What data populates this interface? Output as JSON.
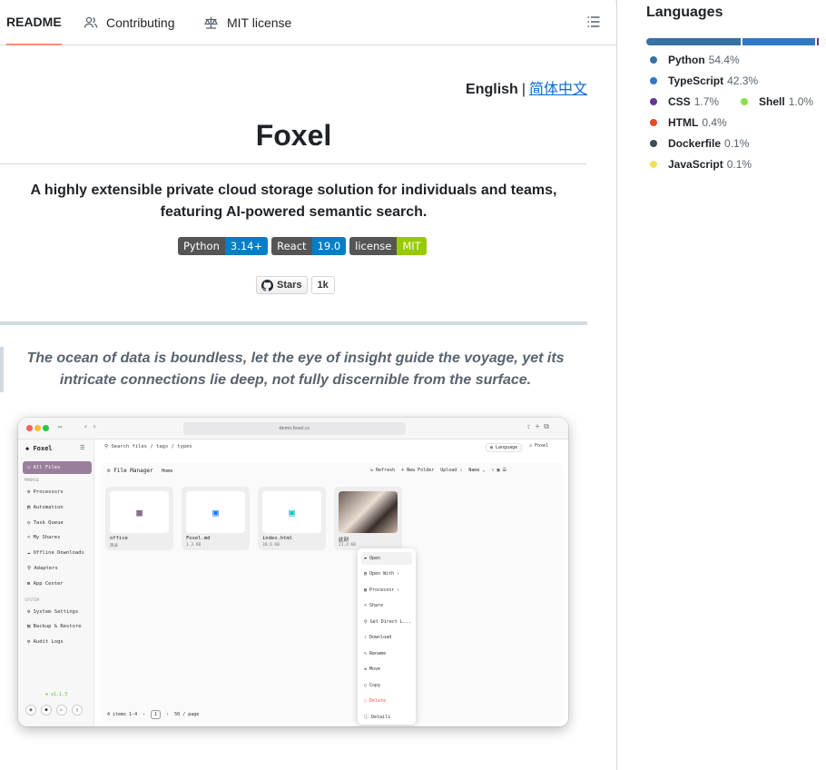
{
  "tabs": {
    "readme": "README",
    "contributing": "Contributing",
    "license": "MIT license"
  },
  "lang_switch": {
    "english": "English",
    "separator": "|",
    "chinese": "简体中文"
  },
  "title": "Foxel",
  "tagline_line1": "A highly extensible private cloud storage solution for individuals and teams,",
  "tagline_line2": "featuring AI-powered semantic search.",
  "badges": [
    {
      "label": "Python",
      "value": "3.14+",
      "color": "#007ec6"
    },
    {
      "label": "React",
      "value": "19.0",
      "color": "#007ec6"
    },
    {
      "label": "license",
      "value": "MIT",
      "color": "#97ca00"
    }
  ],
  "stars": {
    "label": "Stars",
    "count": "1k"
  },
  "quote_line1": "The ocean of data is boundless, let the eye of insight guide the voyage, yet its",
  "quote_line2": "intricate connections lie deep, not fully discernible from the surface.",
  "screenshot": {
    "url": "demo.foxel.cc",
    "app_name": "Foxel",
    "search_placeholder": "Search files / tags / types",
    "language_btn": "Language",
    "user": "Foxel",
    "sidebar": {
      "all_files": "All Files",
      "group_manage": "MANAGE",
      "processors": "Processors",
      "automation": "Automation",
      "task_queue": "Task Queue",
      "my_shares": "My Shares",
      "offline_downloads": "Offline Downloads",
      "adapters": "Adapters",
      "app_center": "App Center",
      "group_system": "SYSTEM",
      "system_settings": "System Settings",
      "backup_restore": "Backup & Restore",
      "audit_logs": "Audit Logs",
      "version": "v1.1.3"
    },
    "file_manager": "File Manager",
    "breadcrumb": "Home",
    "tools": {
      "refresh": "Refresh",
      "new_folder": "New Folder",
      "upload": "Upload",
      "sort": "Name"
    },
    "files": [
      {
        "name": "office",
        "size": "目录"
      },
      {
        "name": "Foxel.md",
        "size": "1.3 KB"
      },
      {
        "name": "index.html",
        "size": "30.6 KB"
      },
      {
        "name": "此刻",
        "size": "21.4 KB"
      }
    ],
    "context_menu": {
      "open": "Open",
      "open_with": "Open With",
      "processor": "Processor",
      "share": "Share",
      "direct_link": "Get Direct L...",
      "download": "Download",
      "rename": "Rename",
      "move": "Move",
      "copy": "Copy",
      "delete": "Delete",
      "details": "Details"
    },
    "pager": {
      "items": "4 items 1-4",
      "page": "1",
      "per_page": "50 / page"
    }
  },
  "languages": {
    "heading": "Languages",
    "items": [
      {
        "name": "Python",
        "pct": "54.4%",
        "value": 54.4,
        "color": "#3572A5"
      },
      {
        "name": "TypeScript",
        "pct": "42.3%",
        "value": 42.3,
        "color": "#3178c6"
      },
      {
        "name": "CSS",
        "pct": "1.7%",
        "value": 1.7,
        "color": "#663399"
      },
      {
        "name": "Shell",
        "pct": "1.0%",
        "value": 1.0,
        "color": "#89e051"
      },
      {
        "name": "HTML",
        "pct": "0.4%",
        "value": 0.4,
        "color": "#e34c26"
      },
      {
        "name": "Dockerfile",
        "pct": "0.1%",
        "value": 0.1,
        "color": "#384d54"
      },
      {
        "name": "JavaScript",
        "pct": "0.1%",
        "value": 0.1,
        "color": "#f1e05a"
      }
    ]
  }
}
